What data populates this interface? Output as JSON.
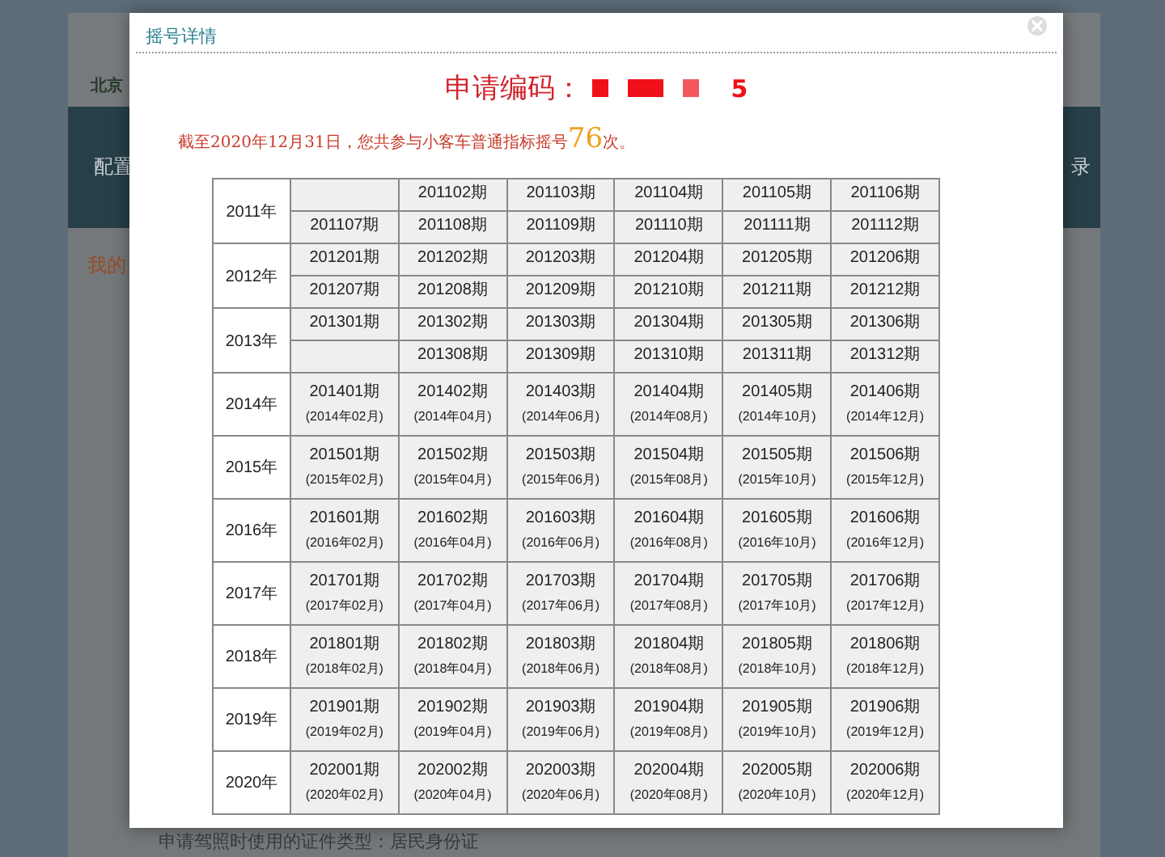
{
  "background_page": {
    "logo_text": "北京",
    "nav_left": "配置",
    "nav_right": "录",
    "section_title": "我的",
    "footer_line": "申请驾照时使用的证件类型：居民身份证"
  },
  "dialog": {
    "title": "摇号详情",
    "code_label": "申请编码：",
    "code_visible_tail": "5",
    "note": {
      "before": "截至2020年12月31日，您共参与小客车普通指标摇号",
      "count": "76",
      "after": "次。"
    }
  },
  "years": [
    {
      "year": "2011年",
      "kind": "split",
      "rows": [
        [
          null,
          "201102期",
          "201103期",
          "201104期",
          "201105期",
          "201106期"
        ],
        [
          "201107期",
          "201108期",
          "201109期",
          "201110期",
          "201111期",
          "201112期"
        ]
      ]
    },
    {
      "year": "2012年",
      "kind": "split",
      "rows": [
        [
          "201201期",
          "201202期",
          "201203期",
          "201204期",
          "201205期",
          "201206期"
        ],
        [
          "201207期",
          "201208期",
          "201209期",
          "201210期",
          "201211期",
          "201212期"
        ]
      ]
    },
    {
      "year": "2013年",
      "kind": "split",
      "rows": [
        [
          "201301期",
          "201302期",
          "201303期",
          "201304期",
          "201305期",
          "201306期"
        ],
        [
          null,
          "201308期",
          "201309期",
          "201310期",
          "201311期",
          "201312期"
        ]
      ]
    },
    {
      "year": "2014年",
      "kind": "dated",
      "cells": [
        {
          "period": "201401期",
          "date": "(2014年02月)"
        },
        {
          "period": "201402期",
          "date": "(2014年04月)"
        },
        {
          "period": "201403期",
          "date": "(2014年06月)"
        },
        {
          "period": "201404期",
          "date": "(2014年08月)"
        },
        {
          "period": "201405期",
          "date": "(2014年10月)"
        },
        {
          "period": "201406期",
          "date": "(2014年12月)"
        }
      ]
    },
    {
      "year": "2015年",
      "kind": "dated",
      "cells": [
        {
          "period": "201501期",
          "date": "(2015年02月)"
        },
        {
          "period": "201502期",
          "date": "(2015年04月)"
        },
        {
          "period": "201503期",
          "date": "(2015年06月)"
        },
        {
          "period": "201504期",
          "date": "(2015年08月)"
        },
        {
          "period": "201505期",
          "date": "(2015年10月)"
        },
        {
          "period": "201506期",
          "date": "(2015年12月)"
        }
      ]
    },
    {
      "year": "2016年",
      "kind": "dated",
      "cells": [
        {
          "period": "201601期",
          "date": "(2016年02月)"
        },
        {
          "period": "201602期",
          "date": "(2016年04月)"
        },
        {
          "period": "201603期",
          "date": "(2016年06月)"
        },
        {
          "period": "201604期",
          "date": "(2016年08月)"
        },
        {
          "period": "201605期",
          "date": "(2016年10月)"
        },
        {
          "period": "201606期",
          "date": "(2016年12月)"
        }
      ]
    },
    {
      "year": "2017年",
      "kind": "dated",
      "cells": [
        {
          "period": "201701期",
          "date": "(2017年02月)"
        },
        {
          "period": "201702期",
          "date": "(2017年04月)"
        },
        {
          "period": "201703期",
          "date": "(2017年06月)"
        },
        {
          "period": "201704期",
          "date": "(2017年08月)"
        },
        {
          "period": "201705期",
          "date": "(2017年10月)"
        },
        {
          "period": "201706期",
          "date": "(2017年12月)"
        }
      ]
    },
    {
      "year": "2018年",
      "kind": "dated",
      "cells": [
        {
          "period": "201801期",
          "date": "(2018年02月)"
        },
        {
          "period": "201802期",
          "date": "(2018年04月)"
        },
        {
          "period": "201803期",
          "date": "(2018年06月)"
        },
        {
          "period": "201804期",
          "date": "(2018年08月)"
        },
        {
          "period": "201805期",
          "date": "(2018年10月)"
        },
        {
          "period": "201806期",
          "date": "(2018年12月)"
        }
      ]
    },
    {
      "year": "2019年",
      "kind": "dated",
      "cells": [
        {
          "period": "201901期",
          "date": "(2019年02月)"
        },
        {
          "period": "201902期",
          "date": "(2019年04月)"
        },
        {
          "period": "201903期",
          "date": "(2019年06月)"
        },
        {
          "period": "201904期",
          "date": "(2019年08月)"
        },
        {
          "period": "201905期",
          "date": "(2019年10月)"
        },
        {
          "period": "201906期",
          "date": "(2019年12月)"
        }
      ]
    },
    {
      "year": "2020年",
      "kind": "dated",
      "cells": [
        {
          "period": "202001期",
          "date": "(2020年02月)"
        },
        {
          "period": "202002期",
          "date": "(2020年04月)"
        },
        {
          "period": "202003期",
          "date": "(2020年06月)"
        },
        {
          "period": "202004期",
          "date": "(2020年08月)"
        },
        {
          "period": "202005期",
          "date": "(2020年10月)"
        },
        {
          "period": "202006期",
          "date": "(2020年12月)"
        }
      ]
    }
  ]
}
